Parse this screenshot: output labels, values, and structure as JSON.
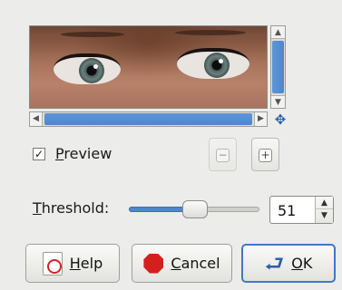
{
  "preview": {
    "checkbox_mark": "✓",
    "label_first": "P",
    "label_rest": "review",
    "checked": true
  },
  "zoom": {
    "out_glyph": "−",
    "in_glyph": "+"
  },
  "threshold": {
    "label_first": "T",
    "label_rest": "hreshold:",
    "value": "51",
    "fraction": 0.51
  },
  "buttons": {
    "help_first": "H",
    "help_rest": "elp",
    "cancel_first": "C",
    "cancel_rest": "ancel",
    "ok_first": "O",
    "ok_rest": "K"
  },
  "colors": {
    "accent": "#4f87c9",
    "cancel": "#d51f1f"
  }
}
